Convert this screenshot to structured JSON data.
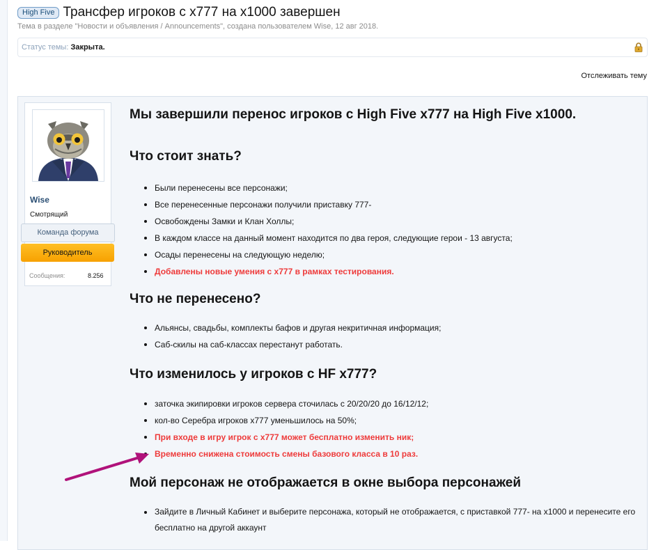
{
  "thread": {
    "prefix": "High Five",
    "title": "Трансфер игроков с x777 на x1000 завершен",
    "description": "Тема в разделе \"Новости и объявления / Announcements\", создана пользователем Wise, 12 авг 2018.",
    "status_label": "Статус темы:",
    "status_value": "Закрыта.",
    "watch_link": "Отслеживать тему"
  },
  "author": {
    "name": "Wise",
    "title": "Смотрящий",
    "banner_team": "Команда форума",
    "banner_role": "Руководитель",
    "stats_label": "Сообщения:",
    "stats_value": "8.256"
  },
  "post": {
    "heading": "Мы завершили перенос игроков с High Five x777 на High Five x1000.",
    "sections": [
      {
        "heading": "Что стоит знать?",
        "items": [
          "Были перенесены все персонажи;",
          "Все перенесенные персонажи получили приставку 777-",
          "Освобождены Замки и Клан Холлы;",
          "В каждом классе на данный момент находится по два героя, следующие герои - 13 августа;",
          "Осады перенесены на следующую неделю;",
          "Добавлены новые умения с x777 в рамках тестирования."
        ]
      },
      {
        "heading": "Что не перенесено?",
        "items": [
          "Альянсы, свадьбы, комплекты бафов и другая некритичная информация;",
          "Саб-скилы на саб-классах перестанут работать."
        ]
      },
      {
        "heading": "Что изменилось у игроков с HF x777?",
        "items": [
          "заточка экипировки игроков сервера сточилась с 20/20/20 до 16/12/12;",
          "кол-во Серебра игроков x777 уменьшилось на 50%;",
          "При входе в игру игрок с x777 может бесплатно изменить ник;",
          "Временно снижена стоимость смены базового класса в 10 раз."
        ]
      },
      {
        "heading": "Мой персонаж не отображается в окне выбора персонажей",
        "items": [
          "Зайдите в Личный Кабинет и выберите персонажа, который не отображается, с приставкой 777- на x1000 и перенесите его бесплатно на другой аккаунт"
        ]
      }
    ]
  },
  "colors": {
    "highlight_red": "#ee3b3b",
    "annotation_arrow": "#b0127a",
    "banner_lead": "#f7a100",
    "link_blue": "#2b4f74"
  },
  "icons": {
    "lock": "lock-icon",
    "avatar": "owl-in-suit-avatar",
    "arrow": "annotation-arrow"
  }
}
